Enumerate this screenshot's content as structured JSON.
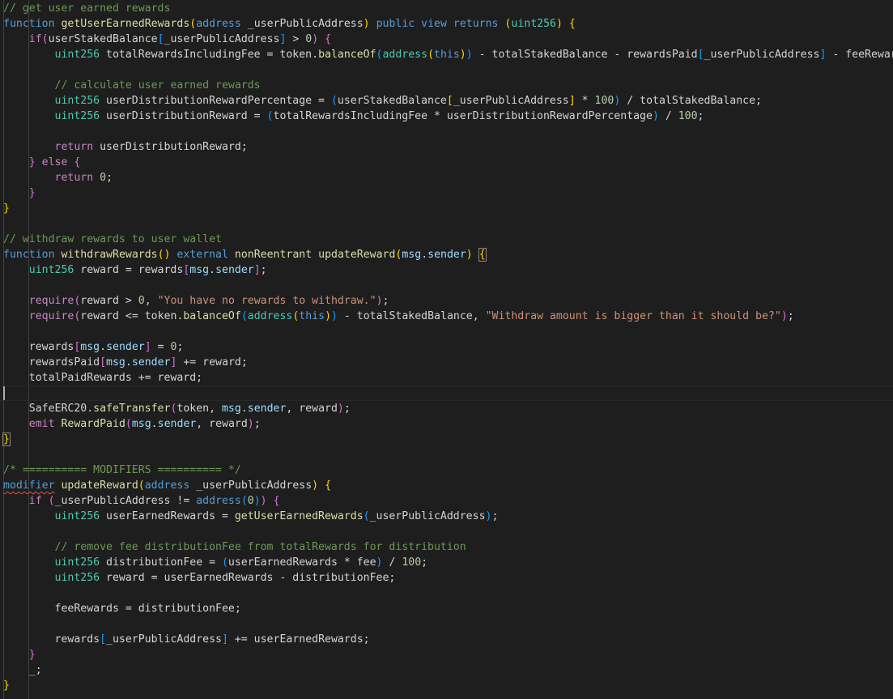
{
  "editor": {
    "theme_colors": {
      "background": "#1e1e1e",
      "default": "#d4d4d4",
      "keyword": "#569cd6",
      "control": "#c586c0",
      "function": "#dcdcaa",
      "type": "#4ec9b0",
      "variable": "#9cdcfe",
      "string": "#ce9178",
      "number": "#b5cea8",
      "comment": "#6a9955",
      "bracket_gold": "#ffd700",
      "bracket_pink": "#da70d6",
      "bracket_blue": "#179fff"
    },
    "current_line": 25,
    "lines": [
      [
        [
          "// get user earned rewards",
          "comment"
        ]
      ],
      [
        [
          "function",
          "keyword"
        ],
        [
          " ",
          ""
        ],
        [
          "getUserEarnedRewards",
          "function"
        ],
        [
          "(",
          "bracket_gold"
        ],
        [
          "address",
          "keyword"
        ],
        [
          " _userPublicAddress",
          ""
        ],
        [
          ")",
          "bracket_gold"
        ],
        [
          " ",
          ""
        ],
        [
          "public",
          "keyword"
        ],
        [
          " ",
          ""
        ],
        [
          "view",
          "keyword"
        ],
        [
          " ",
          ""
        ],
        [
          "returns",
          "keyword"
        ],
        [
          " ",
          ""
        ],
        [
          "(",
          "bracket_gold"
        ],
        [
          "uint256",
          "type"
        ],
        [
          ")",
          "bracket_gold"
        ],
        [
          " ",
          ""
        ],
        [
          "{",
          "bracket_gold"
        ]
      ],
      [
        [
          "    ",
          ""
        ],
        [
          "if",
          "control"
        ],
        [
          "(",
          "bracket_pink"
        ],
        [
          "userStakedBalance",
          ""
        ],
        [
          "[",
          "bracket_blue"
        ],
        [
          "_userPublicAddress",
          ""
        ],
        [
          "]",
          "bracket_blue"
        ],
        [
          " > ",
          ""
        ],
        [
          "0",
          "number"
        ],
        [
          ")",
          "bracket_pink"
        ],
        [
          " ",
          ""
        ],
        [
          "{",
          "bracket_pink"
        ]
      ],
      [
        [
          "        ",
          ""
        ],
        [
          "uint256",
          "type"
        ],
        [
          " totalRewardsIncludingFee = token.",
          ""
        ],
        [
          "balanceOf",
          "function"
        ],
        [
          "(",
          "bracket_blue"
        ],
        [
          "address",
          "type"
        ],
        [
          "(",
          "bracket_gold"
        ],
        [
          "this",
          "keyword"
        ],
        [
          ")",
          "bracket_gold"
        ],
        [
          ")",
          "bracket_blue"
        ],
        [
          " - totalStakedBalance - rewardsPaid",
          ""
        ],
        [
          "[",
          "bracket_blue"
        ],
        [
          "_userPublicAddress",
          ""
        ],
        [
          "]",
          "bracket_blue"
        ],
        [
          " - feeRewards;",
          ""
        ]
      ],
      [],
      [
        [
          "        ",
          ""
        ],
        [
          "// calculate user earned rewards",
          "comment"
        ]
      ],
      [
        [
          "        ",
          ""
        ],
        [
          "uint256",
          "type"
        ],
        [
          " userDistributionRewardPercentage = ",
          ""
        ],
        [
          "(",
          "bracket_blue"
        ],
        [
          "userStakedBalance",
          ""
        ],
        [
          "[",
          "bracket_gold"
        ],
        [
          "_userPublicAddress",
          ""
        ],
        [
          "]",
          "bracket_gold"
        ],
        [
          " * ",
          ""
        ],
        [
          "100",
          "number"
        ],
        [
          ")",
          "bracket_blue"
        ],
        [
          " / totalStakedBalance;",
          ""
        ]
      ],
      [
        [
          "        ",
          ""
        ],
        [
          "uint256",
          "type"
        ],
        [
          " userDistributionReward = ",
          ""
        ],
        [
          "(",
          "bracket_blue"
        ],
        [
          "totalRewardsIncludingFee * userDistributionRewardPercentage",
          ""
        ],
        [
          ")",
          "bracket_blue"
        ],
        [
          " / ",
          ""
        ],
        [
          "100",
          "number"
        ],
        [
          ";",
          ""
        ]
      ],
      [],
      [
        [
          "        ",
          ""
        ],
        [
          "return",
          "control"
        ],
        [
          " userDistributionReward;",
          ""
        ]
      ],
      [
        [
          "    ",
          ""
        ],
        [
          "}",
          "bracket_pink"
        ],
        [
          " ",
          ""
        ],
        [
          "else",
          "control"
        ],
        [
          " ",
          ""
        ],
        [
          "{",
          "bracket_pink"
        ]
      ],
      [
        [
          "        ",
          ""
        ],
        [
          "return",
          "control"
        ],
        [
          " ",
          ""
        ],
        [
          "0",
          "number"
        ],
        [
          ";",
          ""
        ]
      ],
      [
        [
          "    ",
          ""
        ],
        [
          "}",
          "bracket_pink"
        ]
      ],
      [
        [
          "}",
          "bracket_gold"
        ]
      ],
      [],
      [
        [
          "// withdraw rewards to user wallet",
          "comment"
        ]
      ],
      [
        [
          "function",
          "keyword"
        ],
        [
          " ",
          ""
        ],
        [
          "withdrawRewards",
          "function"
        ],
        [
          "()",
          "bracket_gold"
        ],
        [
          " ",
          ""
        ],
        [
          "external",
          "keyword"
        ],
        [
          " ",
          ""
        ],
        [
          "nonReentrant",
          "function"
        ],
        [
          " ",
          ""
        ],
        [
          "updateReward",
          "function"
        ],
        [
          "(",
          "bracket_gold"
        ],
        [
          "msg",
          "variable"
        ],
        [
          ".",
          ""
        ],
        [
          "sender",
          "variable"
        ],
        [
          ")",
          "bracket_gold"
        ],
        [
          " ",
          ""
        ],
        [
          "{",
          "bracket_gold_box"
        ]
      ],
      [
        [
          "    ",
          ""
        ],
        [
          "uint256",
          "type"
        ],
        [
          " reward = rewards",
          ""
        ],
        [
          "[",
          "bracket_pink"
        ],
        [
          "msg",
          "variable"
        ],
        [
          ".",
          ""
        ],
        [
          "sender",
          "variable"
        ],
        [
          "]",
          "bracket_pink"
        ],
        [
          ";",
          ""
        ]
      ],
      [],
      [
        [
          "    ",
          ""
        ],
        [
          "require",
          "control"
        ],
        [
          "(",
          "bracket_pink"
        ],
        [
          "reward > ",
          ""
        ],
        [
          "0",
          "number"
        ],
        [
          ", ",
          ""
        ],
        [
          "\"You have no rewards to withdraw.\"",
          "string"
        ],
        [
          ")",
          "bracket_pink"
        ],
        [
          ";",
          ""
        ]
      ],
      [
        [
          "    ",
          ""
        ],
        [
          "require",
          "control"
        ],
        [
          "(",
          "bracket_pink"
        ],
        [
          "reward <= token.",
          ""
        ],
        [
          "balanceOf",
          "function"
        ],
        [
          "(",
          "bracket_blue"
        ],
        [
          "address",
          "type"
        ],
        [
          "(",
          "bracket_gold"
        ],
        [
          "this",
          "keyword"
        ],
        [
          ")",
          "bracket_gold"
        ],
        [
          ")",
          "bracket_blue"
        ],
        [
          " - totalStakedBalance, ",
          ""
        ],
        [
          "\"Withdraw amount is bigger than it should be?\"",
          "string"
        ],
        [
          ")",
          "bracket_pink"
        ],
        [
          ";",
          ""
        ]
      ],
      [],
      [
        [
          "    rewards",
          ""
        ],
        [
          "[",
          "bracket_pink"
        ],
        [
          "msg",
          "variable"
        ],
        [
          ".",
          ""
        ],
        [
          "sender",
          "variable"
        ],
        [
          "]",
          "bracket_pink"
        ],
        [
          " = ",
          ""
        ],
        [
          "0",
          "number"
        ],
        [
          ";",
          ""
        ]
      ],
      [
        [
          "    rewardsPaid",
          ""
        ],
        [
          "[",
          "bracket_pink"
        ],
        [
          "msg",
          "variable"
        ],
        [
          ".",
          ""
        ],
        [
          "sender",
          "variable"
        ],
        [
          "]",
          "bracket_pink"
        ],
        [
          " += reward;",
          ""
        ]
      ],
      [
        [
          "    totalPaidRewards += reward;",
          ""
        ]
      ],
      [],
      [
        [
          "    SafeERC20.",
          ""
        ],
        [
          "safeTransfer",
          "function"
        ],
        [
          "(",
          "bracket_pink"
        ],
        [
          "token, ",
          ""
        ],
        [
          "msg",
          "variable"
        ],
        [
          ".",
          ""
        ],
        [
          "sender",
          "variable"
        ],
        [
          ", reward",
          ""
        ],
        [
          ")",
          "bracket_pink"
        ],
        [
          ";",
          ""
        ]
      ],
      [
        [
          "    ",
          ""
        ],
        [
          "emit",
          "control"
        ],
        [
          " ",
          ""
        ],
        [
          "RewardPaid",
          "function"
        ],
        [
          "(",
          "bracket_pink"
        ],
        [
          "msg",
          "variable"
        ],
        [
          ".",
          ""
        ],
        [
          "sender",
          "variable"
        ],
        [
          ", reward",
          ""
        ],
        [
          ")",
          "bracket_pink"
        ],
        [
          ";",
          ""
        ]
      ],
      [
        [
          "}",
          "bracket_gold_box"
        ]
      ],
      [],
      [
        [
          "/* ========== MODIFIERS ========== */",
          "comment"
        ]
      ],
      [
        [
          "modifier",
          "keyword_squiggle"
        ],
        [
          " ",
          ""
        ],
        [
          "updateReward",
          "function"
        ],
        [
          "(",
          "bracket_gold"
        ],
        [
          "address",
          "keyword"
        ],
        [
          " _userPublicAddress",
          ""
        ],
        [
          ")",
          "bracket_gold"
        ],
        [
          " ",
          ""
        ],
        [
          "{",
          "bracket_gold"
        ]
      ],
      [
        [
          "    ",
          ""
        ],
        [
          "if",
          "control"
        ],
        [
          " ",
          ""
        ],
        [
          "(",
          "bracket_pink"
        ],
        [
          "_userPublicAddress != ",
          ""
        ],
        [
          "address",
          "keyword"
        ],
        [
          "(",
          "bracket_blue"
        ],
        [
          "0",
          "number"
        ],
        [
          ")",
          "bracket_blue"
        ],
        [
          ")",
          "bracket_pink"
        ],
        [
          " ",
          ""
        ],
        [
          "{",
          "bracket_pink"
        ]
      ],
      [
        [
          "        ",
          ""
        ],
        [
          "uint256",
          "type"
        ],
        [
          " userEarnedRewards = ",
          ""
        ],
        [
          "getUserEarnedRewards",
          "function"
        ],
        [
          "(",
          "bracket_blue"
        ],
        [
          "_userPublicAddress",
          ""
        ],
        [
          ")",
          "bracket_blue"
        ],
        [
          ";",
          ""
        ]
      ],
      [],
      [
        [
          "        ",
          ""
        ],
        [
          "// remove fee distributionFee from totalRewards for distribution",
          "comment"
        ]
      ],
      [
        [
          "        ",
          ""
        ],
        [
          "uint256",
          "type"
        ],
        [
          " distributionFee = ",
          ""
        ],
        [
          "(",
          "bracket_blue"
        ],
        [
          "userEarnedRewards * fee",
          ""
        ],
        [
          ")",
          "bracket_blue"
        ],
        [
          " / ",
          ""
        ],
        [
          "100",
          "number"
        ],
        [
          ";",
          ""
        ]
      ],
      [
        [
          "        ",
          ""
        ],
        [
          "uint256",
          "type"
        ],
        [
          " reward = userEarnedRewards - distributionFee;",
          ""
        ]
      ],
      [],
      [
        [
          "        feeRewards = distributionFee;",
          ""
        ]
      ],
      [],
      [
        [
          "        rewards",
          ""
        ],
        [
          "[",
          "bracket_blue"
        ],
        [
          "_userPublicAddress",
          ""
        ],
        [
          "]",
          "bracket_blue"
        ],
        [
          " += userEarnedRewards;",
          ""
        ]
      ],
      [
        [
          "    ",
          ""
        ],
        [
          "}",
          "bracket_pink"
        ]
      ],
      [
        [
          "    _;",
          ""
        ]
      ],
      [
        [
          "}",
          "bracket_gold"
        ]
      ]
    ]
  }
}
